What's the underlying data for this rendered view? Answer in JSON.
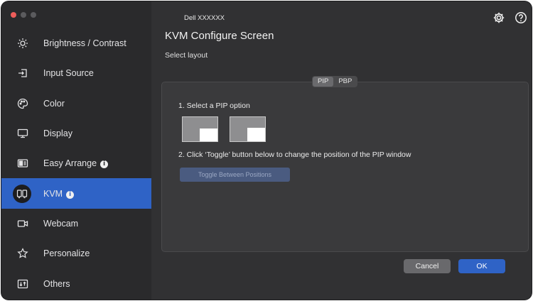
{
  "window": {
    "monitor_name": "Dell XXXXXX"
  },
  "sidebar": {
    "items": [
      {
        "label": "Brightness / Contrast",
        "icon": "sun-icon",
        "info": false,
        "active": false
      },
      {
        "label": "Input Source",
        "icon": "input-source-icon",
        "info": false,
        "active": false
      },
      {
        "label": "Color",
        "icon": "palette-icon",
        "info": false,
        "active": false
      },
      {
        "label": "Display",
        "icon": "monitor-icon",
        "info": false,
        "active": false
      },
      {
        "label": "Easy Arrange",
        "icon": "easy-arrange-icon",
        "info": true,
        "active": false
      },
      {
        "label": "KVM",
        "icon": "kvm-icon",
        "info": true,
        "active": true
      },
      {
        "label": "Webcam",
        "icon": "webcam-icon",
        "info": false,
        "active": false
      },
      {
        "label": "Personalize",
        "icon": "star-icon",
        "info": false,
        "active": false
      },
      {
        "label": "Others",
        "icon": "others-icon",
        "info": false,
        "active": false
      }
    ]
  },
  "header": {
    "title": "KVM Configure Screen",
    "subtitle": "Select layout"
  },
  "layout_tabs": {
    "options": [
      "PIP",
      "PBP"
    ],
    "selected": "PIP"
  },
  "pip": {
    "step1": "1. Select a PIP option",
    "step2": "2. Click ‘Toggle’ button below to change the position of the PIP window",
    "toggle_label": "Toggle Between Positions"
  },
  "footer": {
    "cancel_label": "Cancel",
    "ok_label": "OK"
  },
  "colors": {
    "accent": "#2f63c6",
    "sidebar_bg": "#2a2a2c",
    "main_bg": "#313133",
    "close_dot": "#ed5d5a"
  }
}
